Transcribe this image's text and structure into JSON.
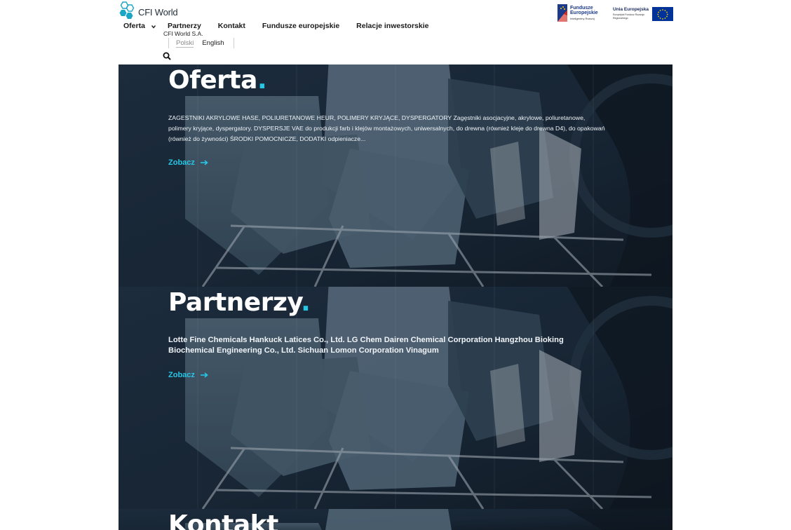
{
  "header": {
    "logo_text": "CFI World",
    "company": "CFI World S.A.",
    "nav": [
      {
        "label": "Oferta",
        "icon": "chevron-down-icon"
      },
      {
        "label": "Partnerzy"
      },
      {
        "label": "Kontakt"
      },
      {
        "label": "Fundusze europejskie"
      },
      {
        "label": "Relacje inwestorskie"
      }
    ],
    "lang": {
      "pl": "Polski",
      "en": "English"
    },
    "search_icon": "search-icon",
    "eu": {
      "fe_title": "Fundusze Europejskie",
      "fe_sub": "Inteligentny Rozwój",
      "ue_title": "Unia Europejska",
      "ue_sub": "Europejski Fundusz Rozwoju Regionalnego"
    }
  },
  "panels": [
    {
      "title": "Oferta",
      "dot": ".",
      "body": "ZAGESTNIKI AKRYLOWE HASE, POLIURETANOWE HEUR, POLIMERY KRYJĄCE, DYSPERGATORY Zagęstniki asocjacyjne, akrylowe, poliuretanowe, polimery kryjące, dyspergatory. DYSPERSJE VAE do produkcji farb i klejów montażowych, uniwersalnych, do drewna (również kleje do drewna D4), do opakowań (również do żywności) ŚRODKI POMOCNICZE, DODATKI odpieniacze...",
      "more": "Zobacz"
    },
    {
      "title": "Partnerzy",
      "dot": ".",
      "body": "Lotte Fine Chemicals Hankuck Latices Co., Ltd. LG Chem Dairen Chemical Corporation Hangzhou Bioking Biochemical Engineering Co., Ltd. Sichuan Lomon Corporation Vinagum",
      "more": "Zobacz"
    },
    {
      "title": "Kontakt"
    }
  ],
  "colors": {
    "accent": "#27c6e6",
    "panel_dark": "#1b2a3a"
  }
}
